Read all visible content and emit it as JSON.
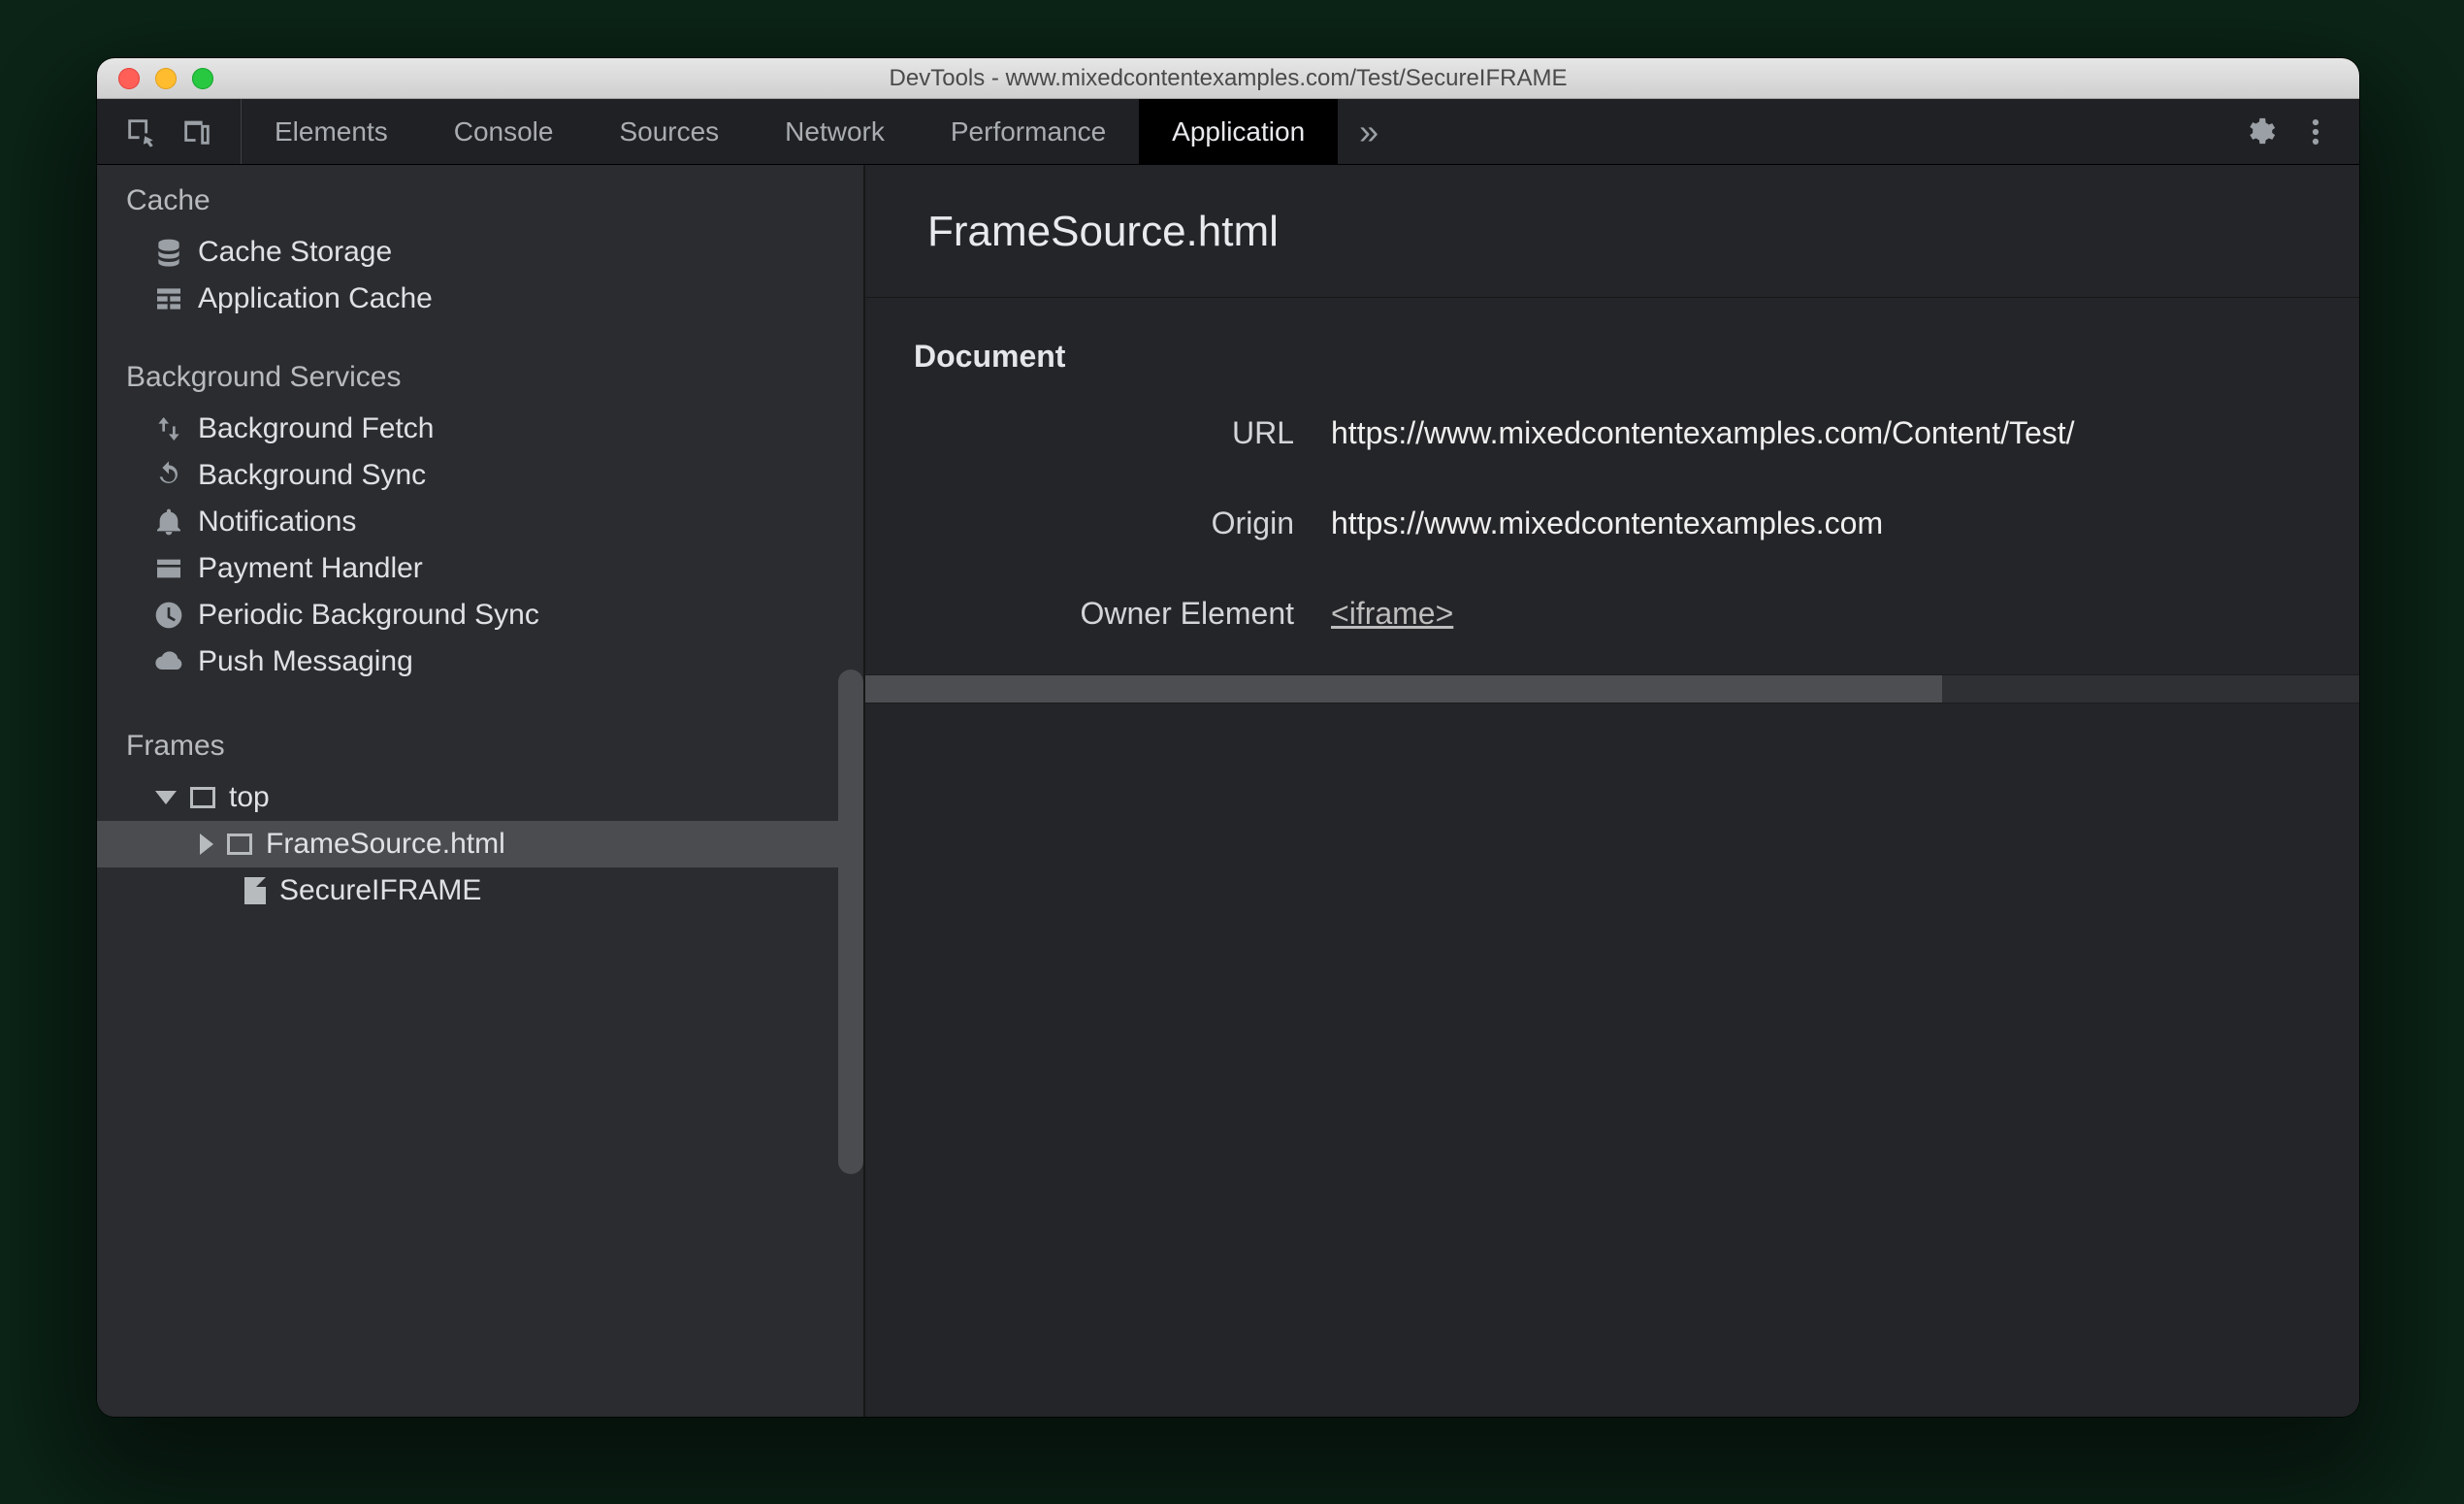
{
  "window": {
    "title": "DevTools - www.mixedcontentexamples.com/Test/SecureIFRAME"
  },
  "tabs": {
    "items": [
      "Elements",
      "Console",
      "Sources",
      "Network",
      "Performance",
      "Application"
    ],
    "active": "Application",
    "overflow_glyph": "»"
  },
  "sidebar": {
    "cache": {
      "title": "Cache",
      "items": [
        "Cache Storage",
        "Application Cache"
      ]
    },
    "bg": {
      "title": "Background Services",
      "items": [
        "Background Fetch",
        "Background Sync",
        "Notifications",
        "Payment Handler",
        "Periodic Background Sync",
        "Push Messaging"
      ]
    },
    "frames": {
      "title": "Frames",
      "top": "top",
      "child": "FrameSource.html",
      "doc": "SecureIFRAME"
    }
  },
  "detail": {
    "heading": "FrameSource.html",
    "section": "Document",
    "url_label": "URL",
    "url_value": "https://www.mixedcontentexamples.com/Content/Test/",
    "origin_label": "Origin",
    "origin_value": "https://www.mixedcontentexamples.com",
    "owner_label": "Owner Element",
    "owner_value": "<iframe>"
  }
}
